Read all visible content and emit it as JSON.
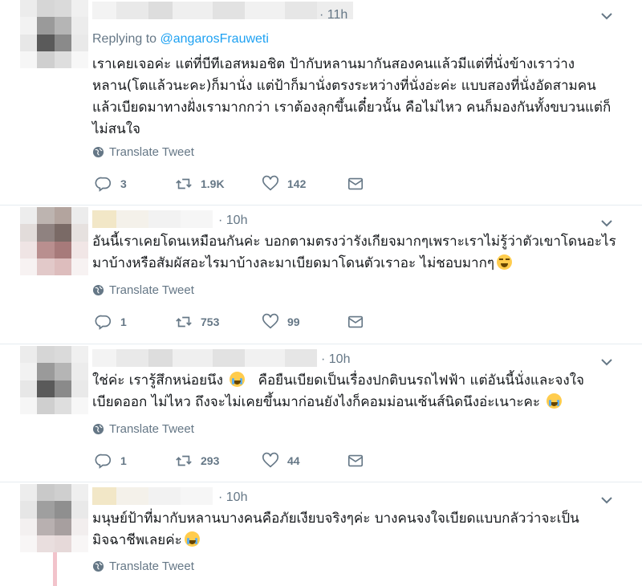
{
  "tweets": [
    {
      "time": "· 11h",
      "replying_prefix": "Replying to",
      "replying_handle": "@angarosFrauweti",
      "lines": [
        "เราเคยเจอค่ะ แต่ที่บีทีเอสหมอชิต ป้ากับหลานมากันสองคนแล้วมีแต่ที่นั่งข้างเราว่าง",
        "หลาน(โตแล้วนะคะ)ก็มานั่ง แต่ป้าก็มานั่งตรงระหว่างที่นั่งอ่ะค่ะ แบบสองที่นั่งอัดสามคน",
        "แล้วเบียดมาทางฝั่งเรามากกว่า เราต้องลุกขึ้นเดี๋ยวนั้น คือไม่ไหว คนก็มองกันทั้งขบวนแต่ก็",
        "ไม่สนใจ"
      ],
      "translate": "Translate Tweet",
      "replies": "3",
      "retweets": "1.9K",
      "likes": "142"
    },
    {
      "time": "· 10h",
      "lines": [
        "อันนี้เราเคยโดนเหมือนกันค่ะ บอกตามตรงว่ารังเกียจมากๆเพราะเราไม่รู้ว่าตัวเขาโดนอะไร",
        "มาบ้างหรือสัมผัสอะไรมาบ้างละมาเบียดมาโดนตัวเราอะ ไม่ชอบมากๆ"
      ],
      "translate": "Translate Tweet",
      "replies": "1",
      "retweets": "753",
      "likes": "99"
    },
    {
      "time": "· 10h",
      "lines": [
        "ใช่ค่ะ เรารู้สึกหน่อยนึง",
        "คือยืนเบียดเป็นเรื่องปกติบนรถไฟฟ้า แต่อันนี้นั่งและจงใจ",
        "เบียดออก ไม่ไหว ถึงจะไม่เคยขึ้นมาก่อนยังไงก็คอมม่อนเซ้นส์นิดนึงอ่ะเนาะคะ"
      ],
      "translate": "Translate Tweet",
      "replies": "1",
      "retweets": "293",
      "likes": "44"
    },
    {
      "time": "· 10h",
      "lines": [
        "มนุษย์ป้าที่มากับหลานบางคนคือภัยเงียบจริงๆค่ะ บางคนจงใจเบียดแบบกลัวว่าจะเป็น",
        "มิจฉาชีพเลยค่ะ"
      ],
      "translate": "Translate Tweet"
    }
  ],
  "icons": {
    "reply": "reply-icon",
    "retweet": "retweet-icon",
    "like": "heart-icon",
    "dm": "envelope-icon",
    "translate": "globe-icon",
    "caret": "chevron-down-icon"
  },
  "colors": {
    "link": "#1da1f2",
    "muted": "#657786",
    "text": "#14171a",
    "thread_line": "#f2c3cb"
  }
}
